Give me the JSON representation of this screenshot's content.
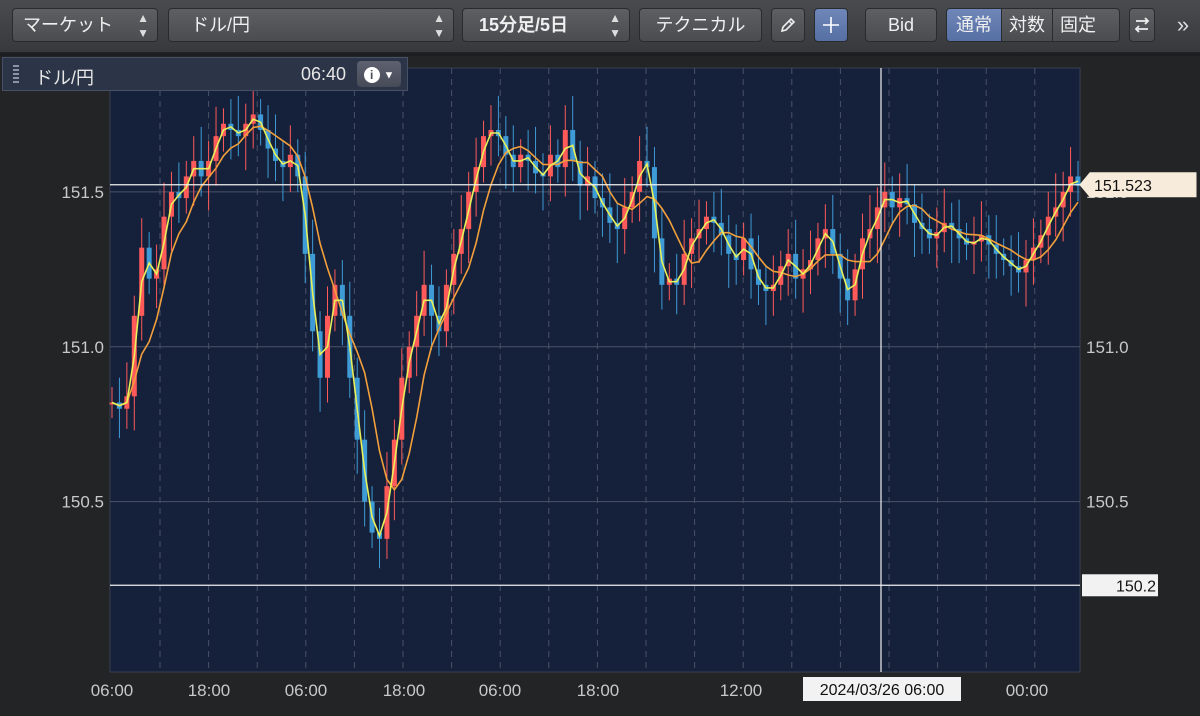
{
  "toolbar": {
    "market_label": "マーケット",
    "pair_label": "ドル/円",
    "period_label": "15分足/5日",
    "technical_label": "テクニカル",
    "pen_icon": "pencil-icon",
    "crosshair_icon": "crosshair-icon",
    "bid_label": "Bid",
    "scale_options": [
      "通常",
      "対数",
      "固定"
    ],
    "scale_selected": "通常",
    "swap_icon": "swap-arrows-icon",
    "more_icon": "double-chevron-right-icon"
  },
  "panel": {
    "symbol": "ドル/円",
    "time": "06:40",
    "info_icon": "info-icon"
  },
  "chart_data": {
    "type": "line",
    "title": "",
    "xlabel": "",
    "ylabel": "",
    "x_tick_labels": [
      "06:00",
      "18:00",
      "06:00",
      "18:00",
      "06:00",
      "18:00",
      "12:00",
      "00:00"
    ],
    "y_tick_labels": [
      "151.5",
      "151.0",
      "150.5"
    ],
    "y_ticks": [
      151.5,
      151.0,
      150.5
    ],
    "ylim": [
      149.95,
      151.9
    ],
    "grid": true,
    "current_price": 151.523,
    "current_price_label": "151.523",
    "hline_value": 150.23,
    "hline_label": "150.2",
    "crosshair_label": "2024/03/26 06:00",
    "colors": {
      "background": "#15203a",
      "up_candle": "#ff5a5a",
      "down_candle": "#3e9bd6",
      "ma_fast": "#e8f05a",
      "ma_slow": "#f2a03c",
      "price_tag": "#f7ecdc"
    },
    "series": [
      {
        "values": [
          150.82,
          150.8,
          150.84,
          151.1,
          151.32,
          151.22,
          151.25,
          151.42,
          151.5,
          151.48,
          151.55,
          151.6,
          151.55,
          151.6,
          151.68,
          151.72,
          151.7,
          151.68,
          151.72,
          151.75,
          151.7,
          151.64,
          151.6,
          151.58,
          151.62,
          151.55,
          151.3,
          151.05,
          150.9,
          151.1,
          151.2,
          151.1,
          150.9,
          150.7,
          150.5,
          150.4,
          150.38,
          150.55,
          150.7,
          150.9,
          151.0,
          151.1,
          151.2,
          151.1,
          151.05,
          151.2,
          151.3,
          151.38,
          151.5,
          151.58,
          151.68,
          151.7,
          151.68,
          151.62,
          151.58,
          151.62,
          151.6,
          151.56,
          151.55,
          151.62,
          151.58,
          151.7,
          151.6,
          151.52,
          151.55,
          151.48,
          151.45,
          151.4,
          151.38,
          151.45,
          151.5,
          151.6,
          151.58,
          151.35,
          151.2,
          151.22,
          151.2,
          151.3,
          151.35,
          151.38,
          151.42,
          151.4,
          151.36,
          151.3,
          151.28,
          151.35,
          151.25,
          151.2,
          151.18,
          151.2,
          151.26,
          151.3,
          151.22,
          151.25,
          151.28,
          151.35,
          151.38,
          151.3,
          151.22,
          151.15,
          151.25,
          151.35,
          151.38,
          151.45,
          151.5,
          151.45,
          151.48,
          151.46,
          151.4,
          151.38,
          151.35,
          151.37,
          151.4,
          151.38,
          151.35,
          151.33,
          151.34,
          151.36,
          151.33,
          151.3,
          151.28,
          151.26,
          151.24,
          151.28,
          151.32,
          151.36,
          151.42,
          151.45,
          151.5,
          151.55,
          151.52
        ]
      }
    ]
  }
}
